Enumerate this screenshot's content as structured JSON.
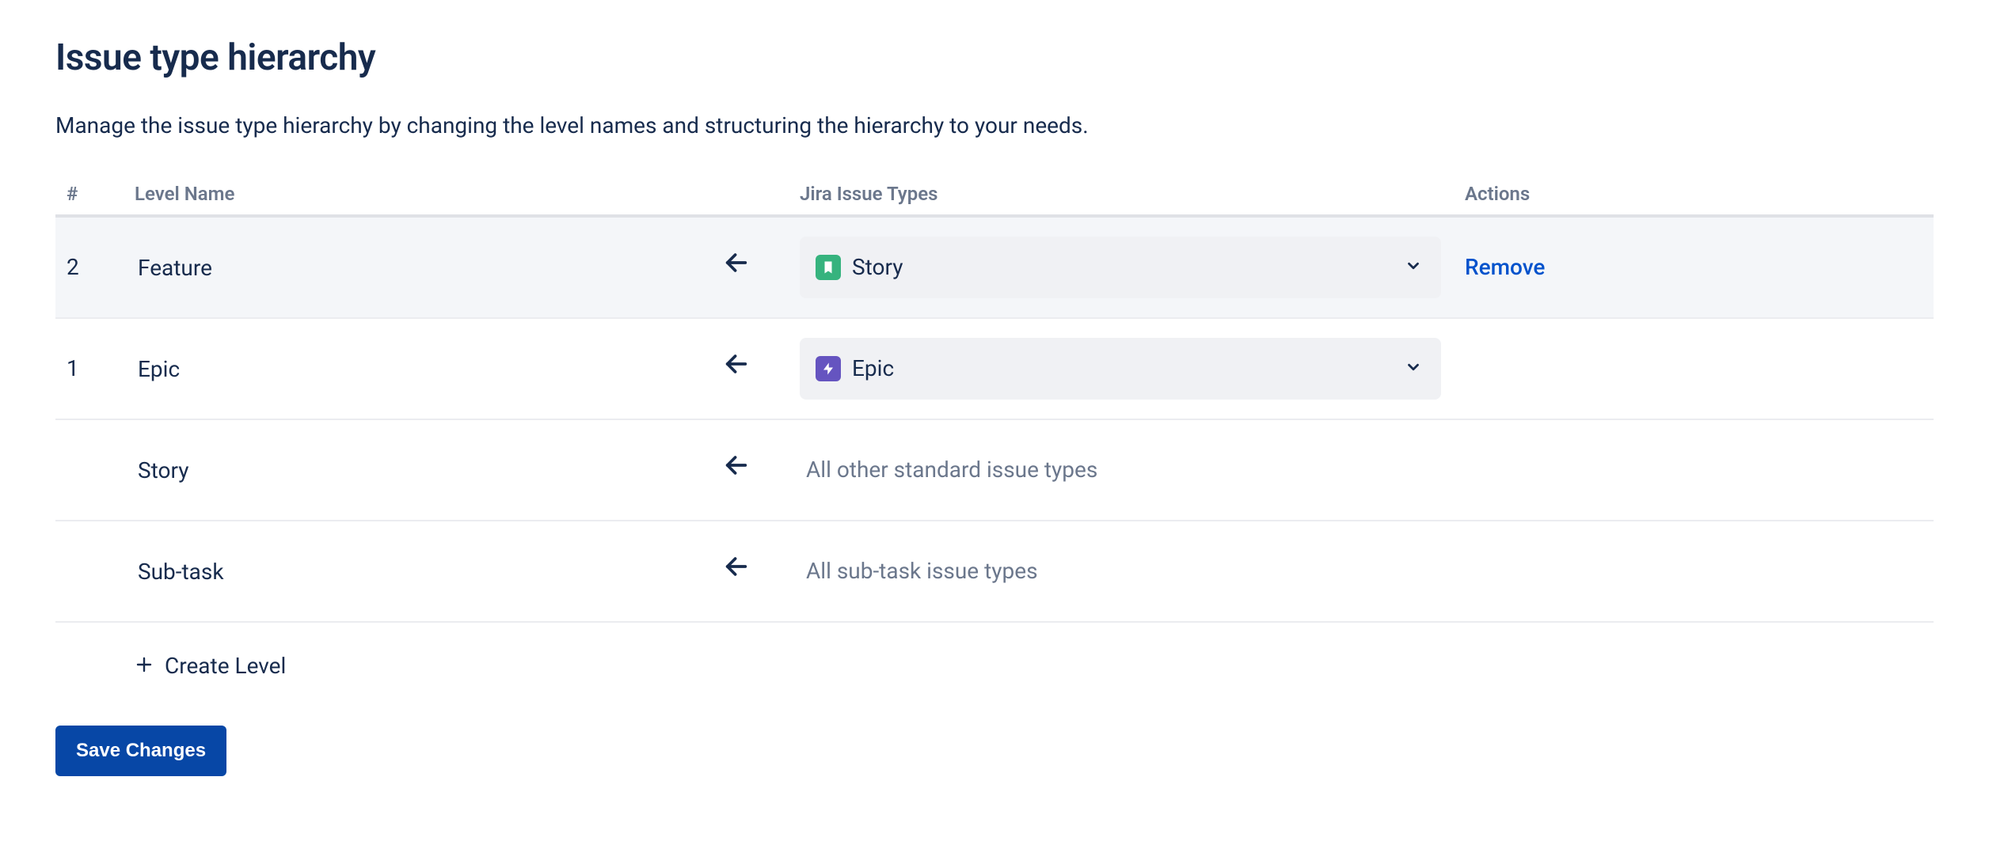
{
  "title": "Issue type hierarchy",
  "description": "Manage the issue type hierarchy by changing the level names and structuring the hierarchy to your needs.",
  "columns": {
    "num": "#",
    "level_name": "Level Name",
    "issue_types": "Jira Issue Types",
    "actions": "Actions"
  },
  "rows": [
    {
      "num": "2",
      "level_name": "Feature",
      "select": {
        "icon": "story",
        "label": "Story"
      },
      "selected": true,
      "action_remove": "Remove"
    },
    {
      "num": "1",
      "level_name": "Epic",
      "select": {
        "icon": "epic",
        "label": "Epic"
      },
      "selected": false
    },
    {
      "num": "",
      "level_name": "Story",
      "text": "All other standard issue types",
      "selected": false
    },
    {
      "num": "",
      "level_name": "Sub-task",
      "text": "All sub-task issue types",
      "selected": false
    }
  ],
  "create_level_label": "Create Level",
  "save_button": "Save Changes"
}
